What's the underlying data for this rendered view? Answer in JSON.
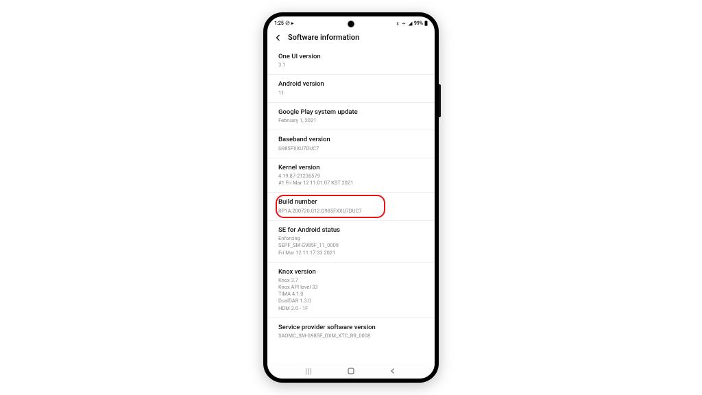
{
  "status": {
    "time": "1:25",
    "battery_text": "99%"
  },
  "header": {
    "title": "Software information"
  },
  "items": [
    {
      "label": "One UI version",
      "value": "3.1"
    },
    {
      "label": "Android version",
      "value": "11"
    },
    {
      "label": "Google Play system update",
      "value": "February 1, 2021"
    },
    {
      "label": "Baseband version",
      "value": "G985FXXU7DUC7"
    },
    {
      "label": "Kernel version",
      "value": "4.19.87-21236579\n#1 Fri Mar 12 11:01:07 KST 2021"
    },
    {
      "label": "Build number",
      "value": "RP1A.200720.012.G985FXXU7DUC7"
    },
    {
      "label": "SE for Android status",
      "value": "Enforcing\nSEPF_SM-G985F_11_0009\nFri Mar 12 11:17:33 2021"
    },
    {
      "label": "Knox version",
      "value": "Knox 3.7\nKnox API level 33\nTIMA 4.1.0\nDualDAR 1.3.0\nHDM 2.0 - 1F"
    },
    {
      "label": "Service provider software version",
      "value": "SAOMC_SM-G985F_OXM_XTC_RR_0008"
    }
  ],
  "highlight_index": 5
}
